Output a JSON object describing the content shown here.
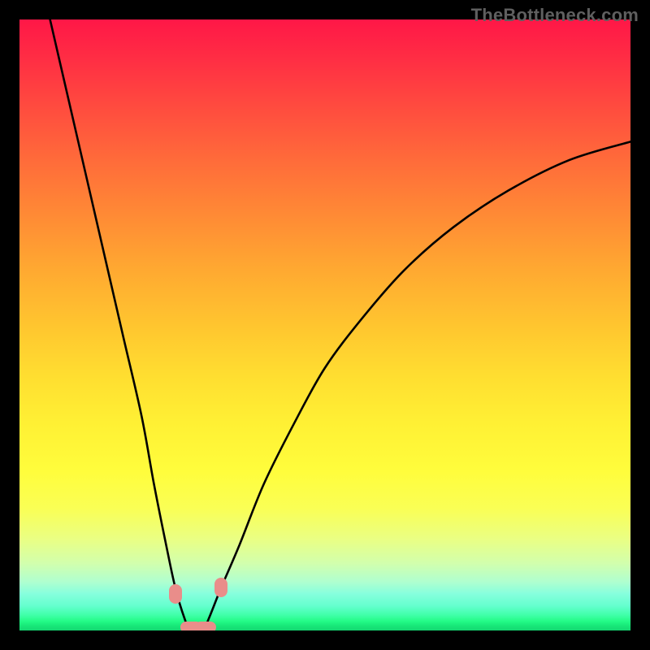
{
  "watermark": "TheBottleneck.com",
  "colors": {
    "frame_border": "#000000",
    "curve_stroke": "#000000",
    "marker_fill": "#e98d8a",
    "gradient_stops": [
      "#ff1747",
      "#ff2c44",
      "#ff4a3f",
      "#ff6b3a",
      "#ff8a35",
      "#ffa931",
      "#ffc52f",
      "#ffdd30",
      "#fff034",
      "#fffd3c",
      "#faff55",
      "#eaff83",
      "#d2ffad",
      "#b0ffcf",
      "#86ffdd",
      "#64ffce",
      "#3fffa8",
      "#23fb86",
      "#18e879",
      "#14d771"
    ]
  },
  "chart_data": {
    "type": "line",
    "title": "",
    "xlabel": "",
    "ylabel": "",
    "xlim": [
      0,
      100
    ],
    "ylim": [
      0,
      100
    ],
    "grid": false,
    "description": "V-shaped bottleneck curve on a vertical red→yellow→green gradient. The curve descends steeply from the top-left, reaches a minimum near x≈28 at y≈0, then rises with decreasing slope toward the top-right, ending near y≈80 at x=100.",
    "series": [
      {
        "name": "bottleneck-curve",
        "x": [
          5,
          8,
          11,
          14,
          17,
          20,
          22,
          24,
          25.5,
          27,
          28,
          30,
          31,
          33,
          36,
          40,
          45,
          50,
          56,
          63,
          71,
          80,
          90,
          100
        ],
        "y": [
          100,
          87,
          74,
          61,
          48,
          35,
          24,
          14,
          7,
          2,
          0,
          0,
          2,
          7,
          14,
          24,
          34,
          43,
          51,
          59,
          66,
          72,
          77,
          80
        ]
      }
    ],
    "markers": [
      {
        "shape": "capsule-vertical",
        "x": 25.5,
        "y": 6
      },
      {
        "shape": "capsule-vertical",
        "x": 33.0,
        "y": 7
      },
      {
        "shape": "capsule-horizontal",
        "x": 28.0,
        "y": 0.5
      },
      {
        "shape": "capsule-horizontal",
        "x": 30.5,
        "y": 0.5
      }
    ],
    "background_scale": {
      "type": "gradient",
      "axis": "y",
      "meaning": "mismatch severity (top=red=high, bottom=green=low)"
    }
  }
}
